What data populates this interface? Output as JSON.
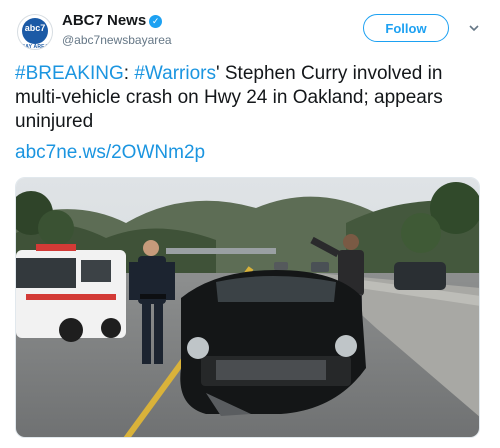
{
  "account": {
    "display_name": "ABC7 News",
    "handle": "@abc7newsbayarea",
    "logo_text": "abc7",
    "logo_subtext": "BAY AREA",
    "verified_icon": "verified-badge-icon"
  },
  "actions": {
    "follow_label": "Follow",
    "menu_icon": "chevron-down-icon"
  },
  "tweet": {
    "hashtag_breaking": "#BREAKING",
    "sep1": ": ",
    "hashtag_warriors": "#Warriors",
    "body": "' Stephen Curry involved in multi-vehicle crash on Hwy 24 in Oakland; appears uninjured",
    "link": "abc7ne.ws/2OWNm2p"
  },
  "colors": {
    "link": "#1b95e0",
    "follow": "#1da1f2",
    "text": "#14171a",
    "muted": "#657786"
  }
}
